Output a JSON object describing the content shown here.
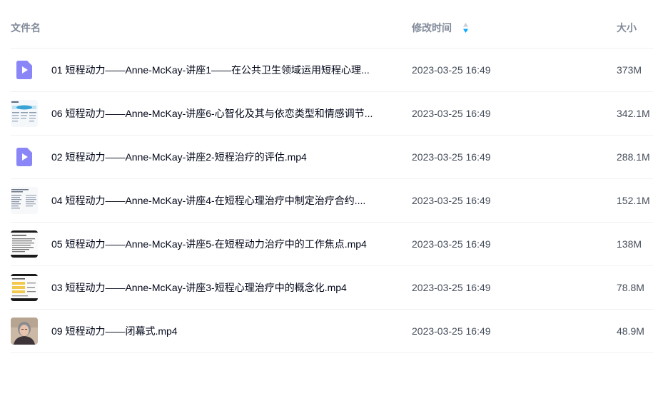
{
  "header": {
    "name_label": "文件名",
    "time_label": "修改时间",
    "size_label": "大小",
    "sort_icon": "sort-arrows-icon"
  },
  "colors": {
    "header_text": "#818999",
    "name_text": "#03081a",
    "meta_text": "#454d5a",
    "video_icon": "#8b86f7",
    "sort_active": "#06a7ff",
    "row_divider": "#f1f2f4"
  },
  "files": [
    {
      "name": "01 短程动力——Anne-McKay-讲座1——在公共卫生领域运用短程心理...",
      "modified": "2023-03-25 16:49",
      "size": "373M",
      "thumb": "video-file-icon"
    },
    {
      "name": "06 短程动力——Anne-McKay-讲座6-心智化及其与依恋类型和情感调节...",
      "modified": "2023-03-25 16:49",
      "size": "342.1M",
      "thumb": "slide-thumbnail"
    },
    {
      "name": "02 短程动力——Anne-McKay-讲座2-短程治疗的评估.mp4",
      "modified": "2023-03-25 16:49",
      "size": "288.1M",
      "thumb": "video-file-icon"
    },
    {
      "name": "04 短程动力——Anne-McKay-讲座4-在短程心理治疗中制定治疗合约....",
      "modified": "2023-03-25 16:49",
      "size": "152.1M",
      "thumb": "slide-thumbnail"
    },
    {
      "name": "05 短程动力——Anne-McKay-讲座5-在短程动力治疗中的工作焦点.mp4",
      "modified": "2023-03-25 16:49",
      "size": "138M",
      "thumb": "slide-thumbnail"
    },
    {
      "name": "03 短程动力——Anne-McKay-讲座3-短程心理治疗中的概念化.mp4",
      "modified": "2023-03-25 16:49",
      "size": "78.8M",
      "thumb": "slide-thumbnail"
    },
    {
      "name": "09 短程动力——闭幕式.mp4",
      "modified": "2023-03-25 16:49",
      "size": "48.9M",
      "thumb": "video-frame-thumbnail"
    }
  ]
}
